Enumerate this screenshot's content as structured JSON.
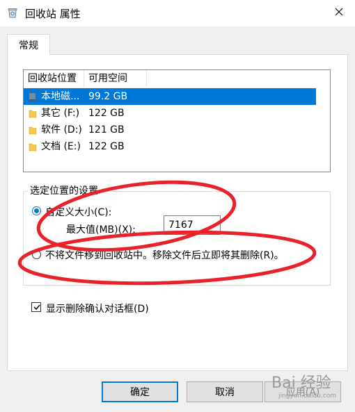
{
  "window": {
    "title": "回收站 属性"
  },
  "tabs": [
    {
      "label": "常规"
    }
  ],
  "list": {
    "columns": [
      "回收站位置",
      "可用空间"
    ],
    "rows": [
      {
        "location": "本地磁...",
        "space": "99.2 GB",
        "selected": true
      },
      {
        "location": "其它 (F:)",
        "space": "122 GB",
        "selected": false
      },
      {
        "location": "软件 (D:)",
        "space": "121 GB",
        "selected": false
      },
      {
        "location": "文档 (E:)",
        "space": "122 GB",
        "selected": false
      }
    ]
  },
  "settings": {
    "group_title": "选定位置的设置",
    "custom_size_label": "自定义大小(C):",
    "max_value_label": "最大值(MB)(X):",
    "max_value": "7167",
    "no_recycle_label": "不将文件移到回收站中。移除文件后立即将其删除(R)。",
    "custom_size_selected": true
  },
  "confirm_delete": {
    "label": "显示删除确认对话框(D)",
    "checked": true
  },
  "buttons": {
    "ok": "确定",
    "cancel": "取消",
    "apply": "应用(A)"
  },
  "watermark": {
    "brand": "Bai 经验",
    "url": "jingyan.baidu.com"
  },
  "colors": {
    "selection": "#0078d7",
    "annotation": "#e8222a"
  }
}
